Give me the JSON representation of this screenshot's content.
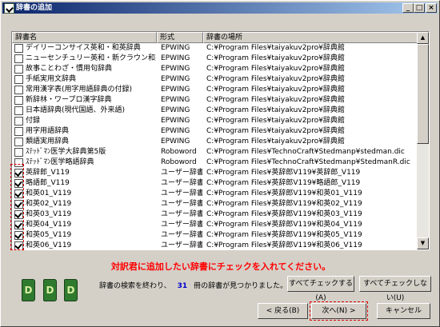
{
  "window": {
    "title": "辞書の追加",
    "buttons": {
      "minimize": "_",
      "maximize": "□",
      "close": "×"
    }
  },
  "table": {
    "columns": [
      "辞書名",
      "形式",
      "辞書の場所"
    ],
    "rows": [
      {
        "checked": false,
        "name": "デイリーコンサイス英和・和英辞典",
        "format": "EPWING",
        "location": "C:¥Program Files¥taiyakuv2pro¥辞典館"
      },
      {
        "checked": false,
        "name": "ニューセンチュリー英和・新クラウン和英辞典",
        "format": "EPWING",
        "location": "C:¥Program Files¥taiyakuv2pro¥辞典館"
      },
      {
        "checked": false,
        "name": "故事ことわざ・慣用句辞典",
        "format": "EPWING",
        "location": "C:¥Program Files¥taiyakuv2pro¥辞典館"
      },
      {
        "checked": false,
        "name": "手紙実用文辞典",
        "format": "EPWING",
        "location": "C:¥Program Files¥taiyakuv2pro¥辞典館"
      },
      {
        "checked": false,
        "name": "常用漢字表(用字用語辞典の付録)",
        "format": "EPWING",
        "location": "C:¥Program Files¥taiyakuv2pro¥辞典館"
      },
      {
        "checked": false,
        "name": "新辞林・ワープロ漢字辞典",
        "format": "EPWING",
        "location": "C:¥Program Files¥taiyakuv2pro¥辞典館"
      },
      {
        "checked": false,
        "name": "日本語辞典(現代国語、外来語)",
        "format": "EPWING",
        "location": "C:¥Program Files¥taiyakuv2pro¥辞典館"
      },
      {
        "checked": false,
        "name": "付録",
        "format": "EPWING",
        "location": "C:¥Program Files¥taiyakuv2pro¥辞典館"
      },
      {
        "checked": false,
        "name": "用字用語辞典",
        "format": "EPWING",
        "location": "C:¥Program Files¥taiyakuv2pro¥辞典館"
      },
      {
        "checked": false,
        "name": "類語実用辞典",
        "format": "EPWING",
        "location": "C:¥Program Files¥taiyakuv2pro¥辞典館"
      },
      {
        "checked": false,
        "name": "ｽﾃｯﾄﾞﾏﾝ医学大辞典第5版",
        "format": "Roboword",
        "location": "C:¥Program Files¥TechnoCraft¥Stedmanp¥stedman.dic"
      },
      {
        "checked": false,
        "name": "ｽﾃｯﾄﾞﾏﾝ医学略語辞典",
        "format": "Roboword",
        "location": "C:¥Program Files¥TechnoCraft¥Stedmanp¥StedmanR.dic"
      },
      {
        "checked": true,
        "name": "英辞郎_V119",
        "format": "ユーザー辞書",
        "location": "C:¥Program Files¥英辞郎V119¥英辞郎_V119"
      },
      {
        "checked": true,
        "name": "略語郎_V119",
        "format": "ユーザー辞書",
        "location": "C:¥Program Files¥英辞郎V119¥略語郎_V119"
      },
      {
        "checked": true,
        "name": "和英01_V119",
        "format": "ユーザー辞書",
        "location": "C:¥Program Files¥英辞郎V119¥和英01_V119"
      },
      {
        "checked": true,
        "name": "和英02_V119",
        "format": "ユーザー辞書",
        "location": "C:¥Program Files¥英辞郎V119¥和英02_V119"
      },
      {
        "checked": true,
        "name": "和英03_V119",
        "format": "ユーザー辞書",
        "location": "C:¥Program Files¥英辞郎V119¥和英03_V119"
      },
      {
        "checked": true,
        "name": "和英04_V119",
        "format": "ユーザー辞書",
        "location": "C:¥Program Files¥英辞郎V119¥和英04_V119"
      },
      {
        "checked": true,
        "name": "和英05_V119",
        "format": "ユーザー辞書",
        "location": "C:¥Program Files¥英辞郎V119¥和英05_V119"
      },
      {
        "checked": true,
        "name": "和英06_V119",
        "format": "ユーザー辞書",
        "location": "C:¥Program Files¥英辞郎V119¥和英06_V119"
      }
    ]
  },
  "instruction": "対訳君に追加したい辞書にチェックを入れてください。",
  "status": {
    "prefix": "辞書の検索を終わり、",
    "count": "31",
    "suffix": "冊の辞書が見つかりました。"
  },
  "icons": {
    "book_letter": "D"
  },
  "buttons": {
    "check_all": "すべてチェックする(A)",
    "uncheck_all": "すべてチェックしない(U)",
    "back": "< 戻る(B)",
    "next": "次へ(N) >",
    "cancel": "キャンセル"
  }
}
